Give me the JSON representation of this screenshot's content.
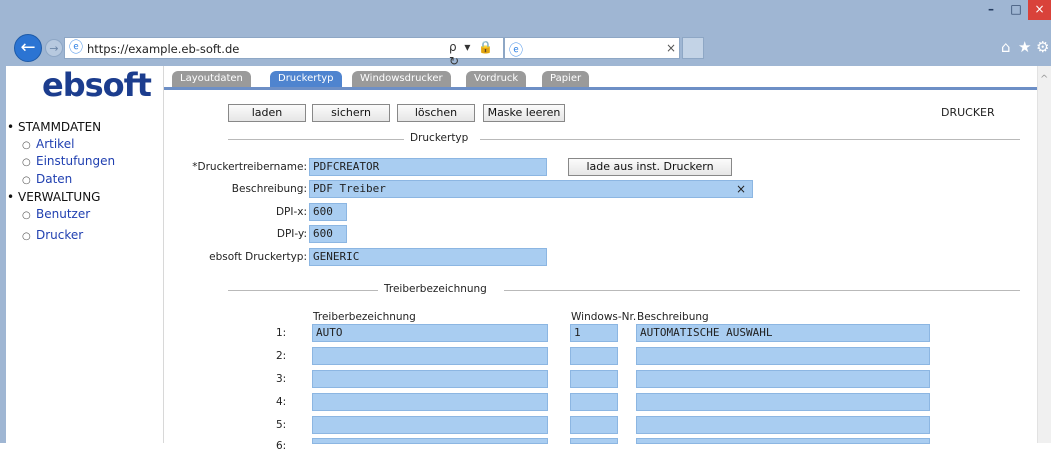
{
  "browser": {
    "url": "https://example.eb-soft.de",
    "addr_tools": "ρ ▾ 🔒 ↻",
    "tab_close": "×",
    "min": "–",
    "max": "□",
    "close": "×"
  },
  "logo": "ebsoft",
  "sidebar": {
    "sections": [
      {
        "label": "STAMMDATEN",
        "items": [
          "Artikel",
          "Einstufungen",
          "Daten"
        ]
      },
      {
        "label": "VERWALTUNG",
        "items": [
          "Benutzer",
          "Drucker"
        ]
      }
    ]
  },
  "tabs": [
    {
      "label": "Layoutdaten",
      "active": false
    },
    {
      "label": "Druckertyp",
      "active": true
    },
    {
      "label": "Windowsdrucker",
      "active": false
    },
    {
      "label": "Vordruck",
      "active": false
    },
    {
      "label": "Papier",
      "active": false
    }
  ],
  "toolbar": {
    "load": "laden",
    "save": "sichern",
    "delete": "löschen",
    "clear_mask": "Maske leeren",
    "context_label": "DRUCKER"
  },
  "druckertyp": {
    "section_title": "Druckertyp",
    "driver_name_label": "*Druckertreibername:",
    "driver_name_value": "PDFCREATOR",
    "load_from_installed": "lade aus inst. Druckern",
    "description_label": "Beschreibung:",
    "description_value": "PDF Treiber",
    "clear_icon": "×",
    "dpi_x_label": "DPI-x:",
    "dpi_x_value": "600",
    "dpi_y_label": "DPI-y:",
    "dpi_y_value": "600",
    "ebsoft_type_label": "ebsoft Druckertyp:",
    "ebsoft_type_value": "GENERIC"
  },
  "treiber": {
    "section_title": "Treiberbezeichnung",
    "col_name": "Treiberbezeichnung",
    "col_winnr": "Windows-Nr.",
    "col_desc": "Beschreibung",
    "rows": [
      {
        "num": "1:",
        "name": "AUTO",
        "winnr": "1",
        "desc": "AUTOMATISCHE AUSWAHL"
      },
      {
        "num": "2:",
        "name": "",
        "winnr": "",
        "desc": ""
      },
      {
        "num": "3:",
        "name": "",
        "winnr": "",
        "desc": ""
      },
      {
        "num": "4:",
        "name": "",
        "winnr": "",
        "desc": ""
      },
      {
        "num": "5:",
        "name": "",
        "winnr": "",
        "desc": ""
      },
      {
        "num": "6:",
        "name": "",
        "winnr": "",
        "desc": ""
      }
    ]
  },
  "colors": {
    "chrome": "#9fb6d3",
    "input_bg": "#a9cdf1",
    "active_tab": "#4f84cf",
    "inactive_tab": "#9a9a9a",
    "logo": "#1c3d8e",
    "link": "#1f3fb0"
  }
}
